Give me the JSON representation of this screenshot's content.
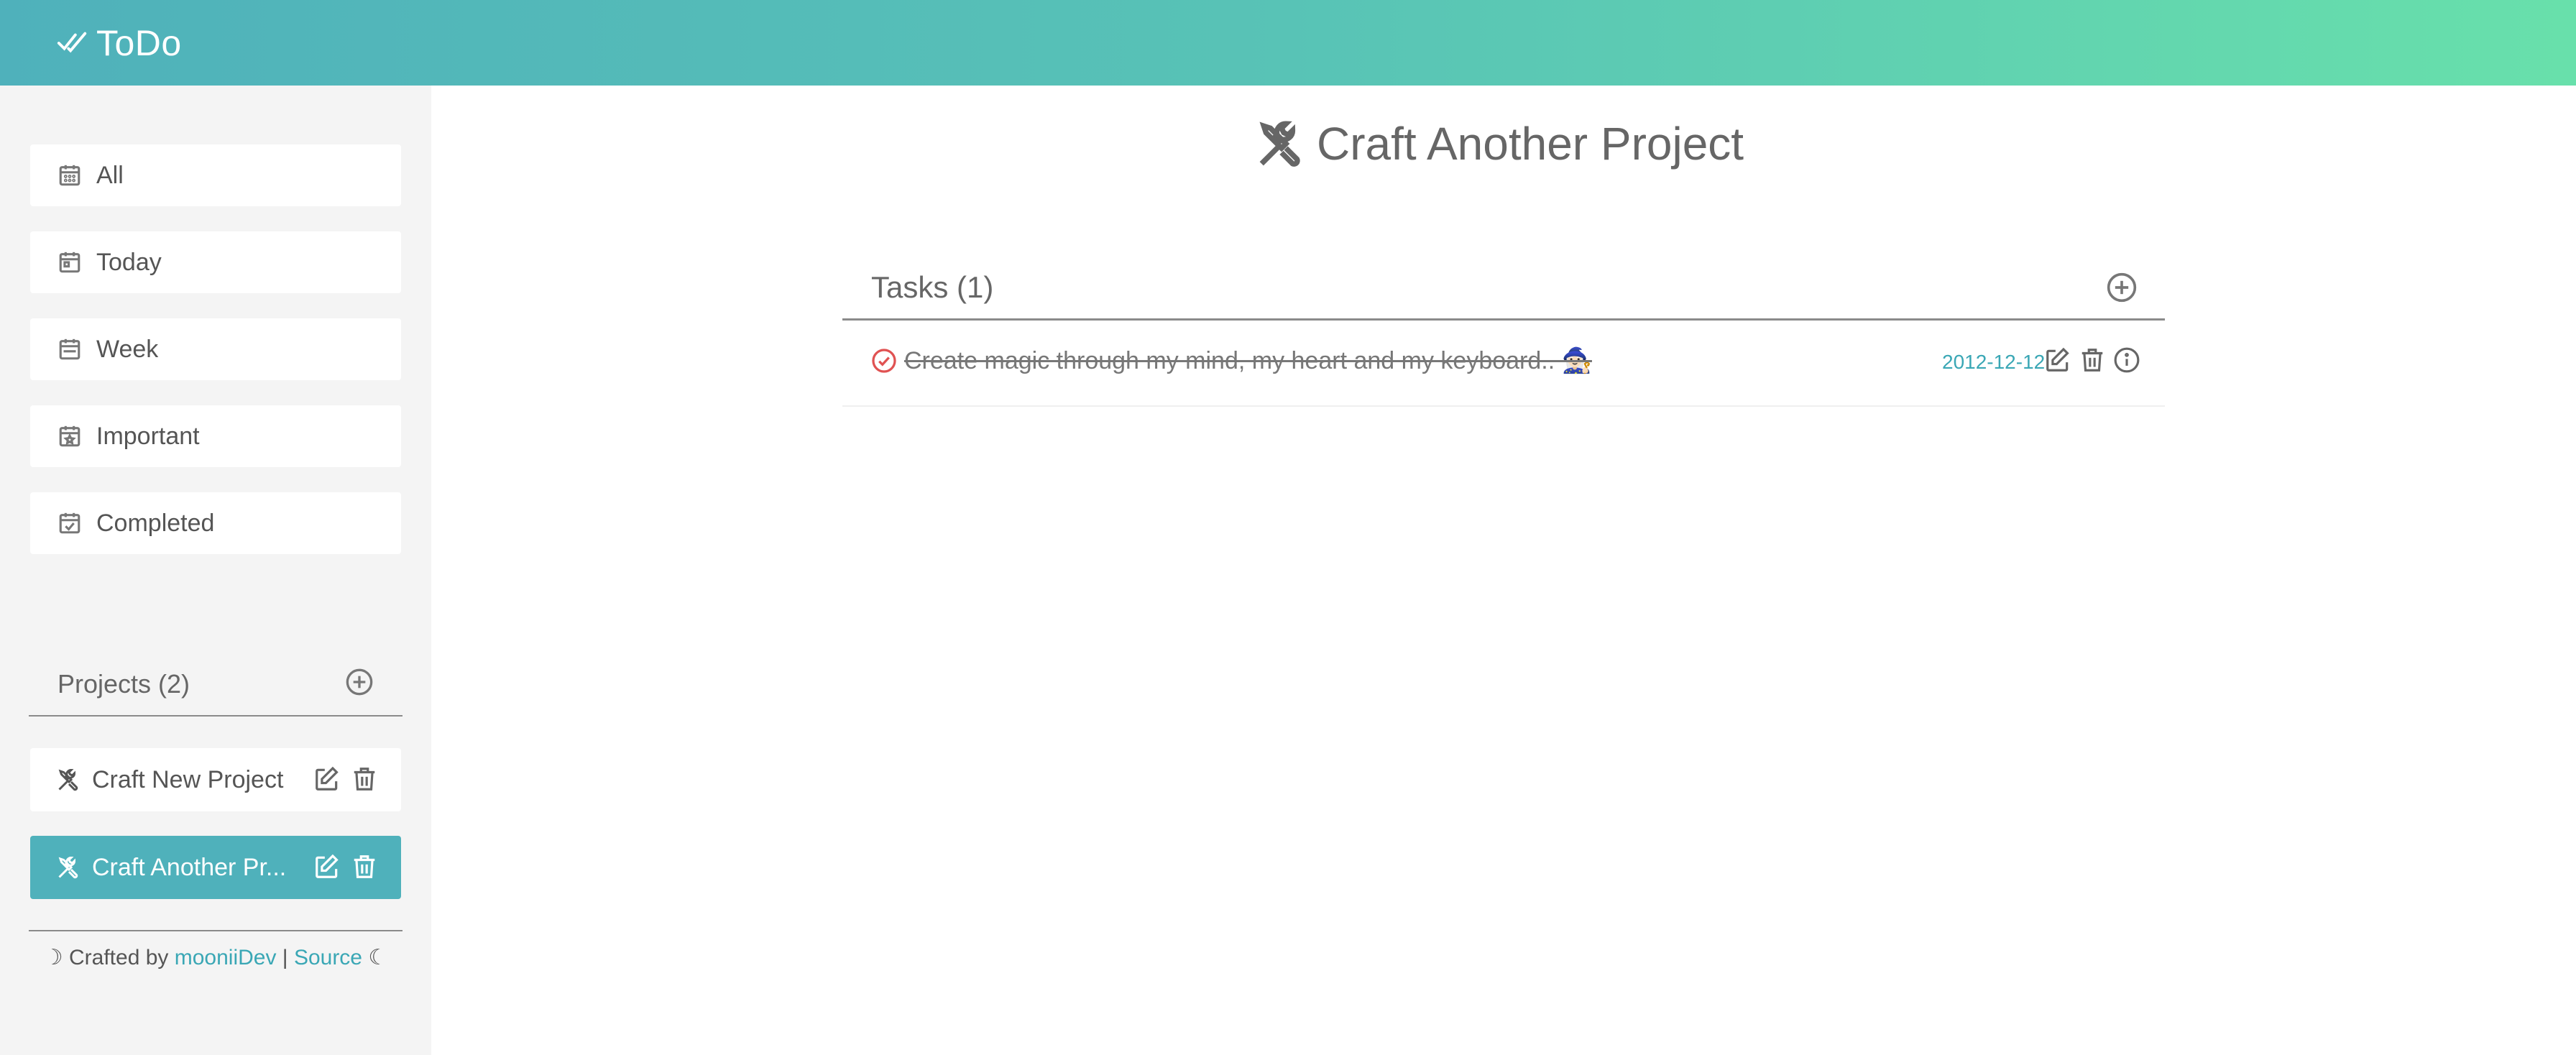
{
  "app": {
    "title": "ToDo"
  },
  "sidebar": {
    "nav": [
      {
        "label": "All",
        "icon": "calendar-icon"
      },
      {
        "label": "Today",
        "icon": "calendar-day-icon"
      },
      {
        "label": "Week",
        "icon": "calendar-week-icon"
      },
      {
        "label": "Important",
        "icon": "calendar-star-icon"
      },
      {
        "label": "Completed",
        "icon": "calendar-check-icon"
      }
    ],
    "projects": {
      "title": "Projects (2)",
      "items": [
        {
          "name": "Craft New Project",
          "active": false
        },
        {
          "name": "Craft Another Pr...",
          "active": true
        }
      ]
    },
    "footer": {
      "prefix": "☽ Crafted by ",
      "author": "mooniiDev",
      "separator": " | ",
      "source": "Source",
      "suffix": " ☾"
    }
  },
  "main": {
    "project_title": "Craft Another Project",
    "tasks_title": "Tasks (1)",
    "tasks": [
      {
        "text": "Create magic through my mind, my heart and my keyboard.. 🧙🏻‍♀️",
        "date": "2012-12-12",
        "completed": true
      }
    ]
  },
  "colors": {
    "accent": "#4fb1bb",
    "header_gradient_start": "#4fb1bb",
    "header_gradient_end": "#68e0ab",
    "link": "#3aa7b5",
    "completed_check": "#e05252"
  }
}
